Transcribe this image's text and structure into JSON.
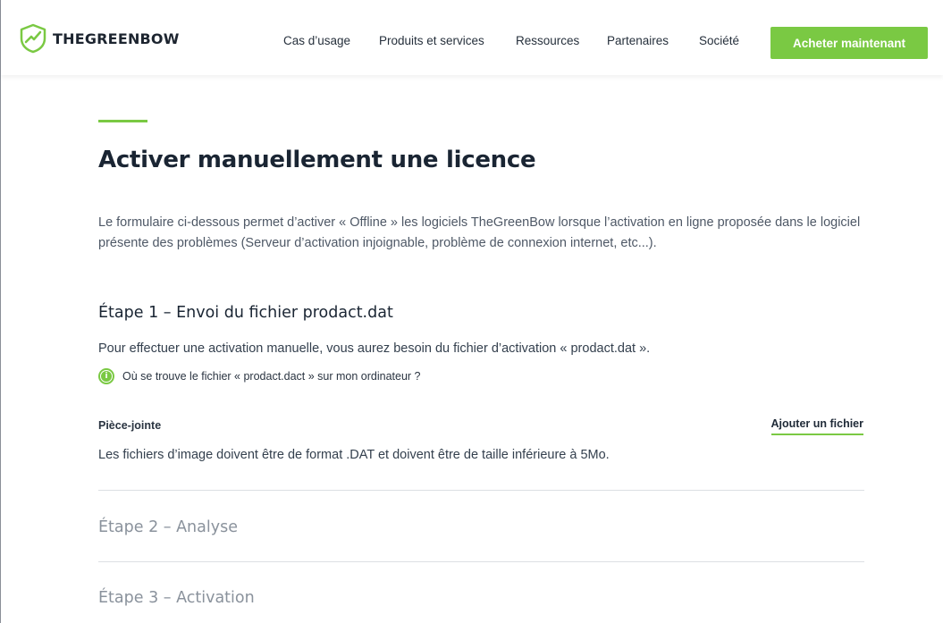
{
  "brand": {
    "name": "THEGREENBOW",
    "accent_color": "#7ac943",
    "logo_icon": "shield-check-icon"
  },
  "nav": {
    "items": [
      {
        "label": "Cas d’usage"
      },
      {
        "label": "Produits et services"
      },
      {
        "label": "Ressources"
      },
      {
        "label": "Partenaires"
      },
      {
        "label": "Société"
      }
    ],
    "cta_label": "Acheter maintenant"
  },
  "page": {
    "title": "Activer manuellement une licence",
    "intro": "Le formulaire ci-dessous permet d’activer « Offline » les logiciels TheGreenBow lorsque l’activation en ligne proposée dans le logiciel présente des problèmes (Serveur d’activation injoignable, problème de connexion internet, etc...)."
  },
  "step1": {
    "title": "Étape 1 – Envoi du fichier prodact.dat",
    "description": "Pour effectuer une activation manuelle, vous aurez besoin du fichier d’activation « prodact.dat ».",
    "info_link": "Où se trouve le fichier « prodact.dact » sur mon ordinateur ?",
    "info_icon": "info-icon",
    "attachment_label": "Pièce-jointe",
    "add_file_label": "Ajouter un fichier",
    "file_note": "Les fichiers d’image doivent être de format .DAT et doivent être de taille inférieure à 5Mo."
  },
  "step2": {
    "title": "Étape 2 – Analyse"
  },
  "step3": {
    "title": "Étape 3 – Activation"
  }
}
